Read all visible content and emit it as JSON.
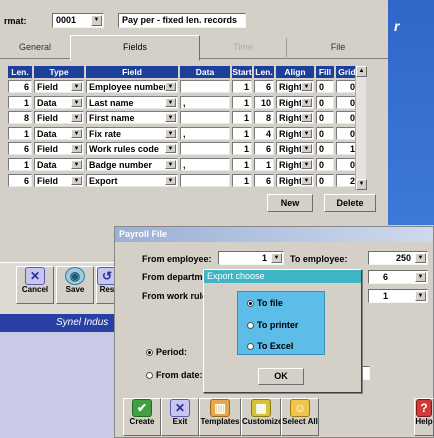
{
  "format": {
    "label": "rmat:",
    "code": "0001",
    "description": "Pay per - fixed len. records"
  },
  "tabs": [
    {
      "label": "General"
    },
    {
      "label": "Fields"
    },
    {
      "label": "Time"
    },
    {
      "label": "File"
    }
  ],
  "grid": {
    "headers": [
      "Len.",
      "Type",
      "Field",
      "Data",
      "Start",
      "Len.",
      "Align",
      "Fill",
      "Grid"
    ],
    "rows": [
      {
        "len": "6",
        "type": "Field",
        "field": "Employee number",
        "data": "",
        "start": "1",
        "len2": "6",
        "align": "Right",
        "fill": "0",
        "grid": "0"
      },
      {
        "len": "1",
        "type": "Data",
        "field": "Last name",
        "data": ",",
        "start": "1",
        "len2": "10",
        "align": "Right",
        "fill": "0",
        "grid": "0"
      },
      {
        "len": "8",
        "type": "Field",
        "field": "First name",
        "data": "",
        "start": "1",
        "len2": "8",
        "align": "Right",
        "fill": "0",
        "grid": "0"
      },
      {
        "len": "1",
        "type": "Data",
        "field": "Fix rate",
        "data": ",",
        "start": "1",
        "len2": "4",
        "align": "Right",
        "fill": "0",
        "grid": "0"
      },
      {
        "len": "6",
        "type": "Field",
        "field": "Work rules code",
        "data": "",
        "start": "1",
        "len2": "6",
        "align": "Right",
        "fill": "0",
        "grid": "1"
      },
      {
        "len": "1",
        "type": "Data",
        "field": "Badge number",
        "data": ",",
        "start": "1",
        "len2": "1",
        "align": "Right",
        "fill": "0",
        "grid": "0"
      },
      {
        "len": "6",
        "type": "Field",
        "field": "Export",
        "data": "",
        "start": "1",
        "len2": "6",
        "align": "Right",
        "fill": "0",
        "grid": "2"
      }
    ]
  },
  "buttons": {
    "new": "New",
    "delete": "Delete"
  },
  "back_toolbar": [
    {
      "label": "Cancel",
      "icon": "x-icon"
    },
    {
      "label": "Save",
      "icon": "save-icon"
    },
    {
      "label": "Res",
      "icon": "reset-icon"
    }
  ],
  "footer_brand": "Synel Indus",
  "payroll_dialog": {
    "title": "Payroll File",
    "from_employee_label": "From employee:",
    "from_employee_value": "1",
    "to_employee_label": "To employee:",
    "to_employee_value": "250",
    "from_department_label": "From departmer",
    "department_right_value": "6",
    "from_work_rule_label": "From work rule:",
    "work_rule_right_value": "1",
    "period_label": "Period:",
    "from_date_label": "From date:"
  },
  "export_popup": {
    "title": "Export choose",
    "options": [
      {
        "label": "To file",
        "selected": true
      },
      {
        "label": "To printer",
        "selected": false
      },
      {
        "label": "To Excel",
        "selected": false
      }
    ],
    "ok": "OK"
  },
  "front_toolbar": [
    {
      "label": "Create",
      "icon": "check-icon"
    },
    {
      "label": "Exit",
      "icon": "x-icon"
    },
    {
      "label": "Templates",
      "icon": "templates-icon"
    },
    {
      "label": "Customize",
      "icon": "customize-icon"
    },
    {
      "label": "Select All",
      "icon": "select-all-icon"
    }
  ],
  "help": "Help"
}
